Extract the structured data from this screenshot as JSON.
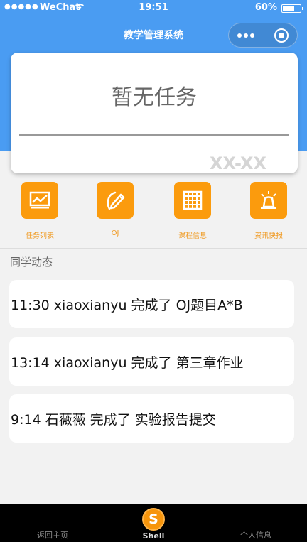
{
  "status_bar": {
    "signal": "●●●●●",
    "carrier": "WeChat",
    "time": "19:51",
    "battery": "60%"
  },
  "nav": {
    "title": "教学管理系统"
  },
  "task_card": {
    "title": "暂无任务",
    "date": "XX-XX"
  },
  "menu": [
    {
      "label": "任务列表",
      "icon": "chart-icon"
    },
    {
      "label": "OJ",
      "icon": "pencil-icon"
    },
    {
      "label": "课程信息",
      "icon": "grid-icon"
    },
    {
      "label": "资讯快报",
      "icon": "alarm-light-icon"
    }
  ],
  "feed": {
    "title": "同学动态",
    "items": [
      "11:30 xiaoxianyu 完成了 OJ题目A*B",
      "13:14 xiaoxianyu 完成了 第三章作业",
      "9:14 石薇薇 完成了 实验报告提交"
    ]
  },
  "tabbar": {
    "home": "返回主页",
    "shell": "Shell",
    "shell_icon_letter": "S",
    "profile": "个人信息"
  },
  "colors": {
    "primary": "#4a9cf2",
    "accent": "#fb9b0d"
  }
}
